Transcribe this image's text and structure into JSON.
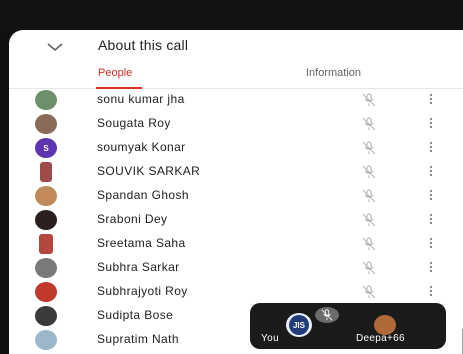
{
  "header": {
    "title": "About this call"
  },
  "tabs": [
    {
      "label": "People",
      "active": true
    },
    {
      "label": "Information",
      "active": false
    }
  ],
  "colors": {
    "accent": "#d93025",
    "text": "#202124",
    "muted": "#5f6368"
  },
  "participants": [
    {
      "name": "sonu kumar jha",
      "avatar": "photo",
      "mic": "mic-off-icon"
    },
    {
      "name": "Sougata Roy",
      "avatar": "photo",
      "mic": "mic-off-icon"
    },
    {
      "name": "soumyak Konar",
      "avatar": "initial",
      "initial": "S",
      "avatar_color": "#5e35b1",
      "mic": "mic-off-icon"
    },
    {
      "name": "SOUVIK SARKAR",
      "avatar": "photo",
      "mic": "mic-off-icon"
    },
    {
      "name": "Spandan Ghosh",
      "avatar": "photo",
      "mic": "mic-off-icon"
    },
    {
      "name": "Sraboni Dey",
      "avatar": "photo",
      "mic": "mic-off-icon"
    },
    {
      "name": "Sreetama Saha",
      "avatar": "photo",
      "mic": "mic-off-icon"
    },
    {
      "name": "Subhra Sarkar",
      "avatar": "photo",
      "mic": "mic-off-icon"
    },
    {
      "name": "Subhrajyoti Roy",
      "avatar": "photo",
      "mic": "mic-off-icon"
    },
    {
      "name": "Sudipta Bose",
      "avatar": "photo",
      "mic": "mic-off-icon"
    },
    {
      "name": "Supratim Nath",
      "avatar": "photo",
      "mic": "mic-off-icon"
    }
  ],
  "pip": {
    "self_label": "You",
    "other_label": "Deepa",
    "overflow_count": "+66",
    "self_logo_text": "JIS"
  }
}
